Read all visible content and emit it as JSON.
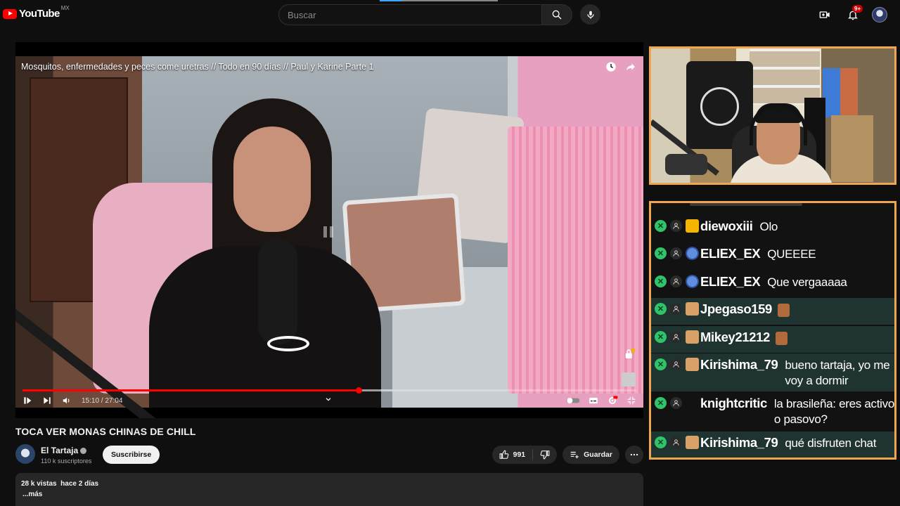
{
  "topbar": {
    "logo_text": "YouTube",
    "country": "MX",
    "search_placeholder": "Buscar",
    "notif_count": "9+"
  },
  "player": {
    "title": "Mosquitos, enfermedades y peces come uretras // Todo en 90 días // Paul y Karine Parte 1",
    "time": "15:10 / 27:04",
    "progress": 0.548,
    "buffered": 0.602
  },
  "video": {
    "title": "TOCA VER MONAS CHINAS DE CHILL",
    "channel": "El Tartaja",
    "subscribers": "110 k suscriptores",
    "subscribe_label": "Suscribirse",
    "likes": "991",
    "save_label": "Guardar",
    "views": "28 k vistas",
    "date": "hace 2 días",
    "more_label": "...más"
  },
  "chat": {
    "messages": [
      {
        "user": "diewoxiii",
        "text": "Olo",
        "badge": "crown",
        "highlight": false,
        "emote": false
      },
      {
        "user": "ELIEX_EX",
        "text": "QUEEEE",
        "badge": "blue-character",
        "highlight": false,
        "emote": false
      },
      {
        "user": "ELIEX_EX",
        "text": "Que vergaaaaa",
        "badge": "blue-character",
        "highlight": false,
        "emote": false
      },
      {
        "user": "Jpegaso159",
        "text": "",
        "badge": "cat-character",
        "highlight": true,
        "emote": true
      },
      {
        "user": "Mikey21212",
        "text": "",
        "badge": "cat-character",
        "highlight": true,
        "emote": true
      },
      {
        "user": "Kirishima_79",
        "text": "bueno tartaja, yo me voy a dormir",
        "badge": "cat-character",
        "highlight": true,
        "emote": false
      },
      {
        "user": "knightcritic",
        "text": "la brasileña: eres activo o pasovo?",
        "badge": "none",
        "highlight": false,
        "emote": false
      },
      {
        "user": "Kirishima_79",
        "text": "qué disfruten chat",
        "badge": "cat-character",
        "highlight": true,
        "emote": false
      }
    ]
  },
  "colors": {
    "accent_red": "#ff0000",
    "overlay_border": "#f0a64e",
    "chat_highlight": "#1f3330"
  }
}
